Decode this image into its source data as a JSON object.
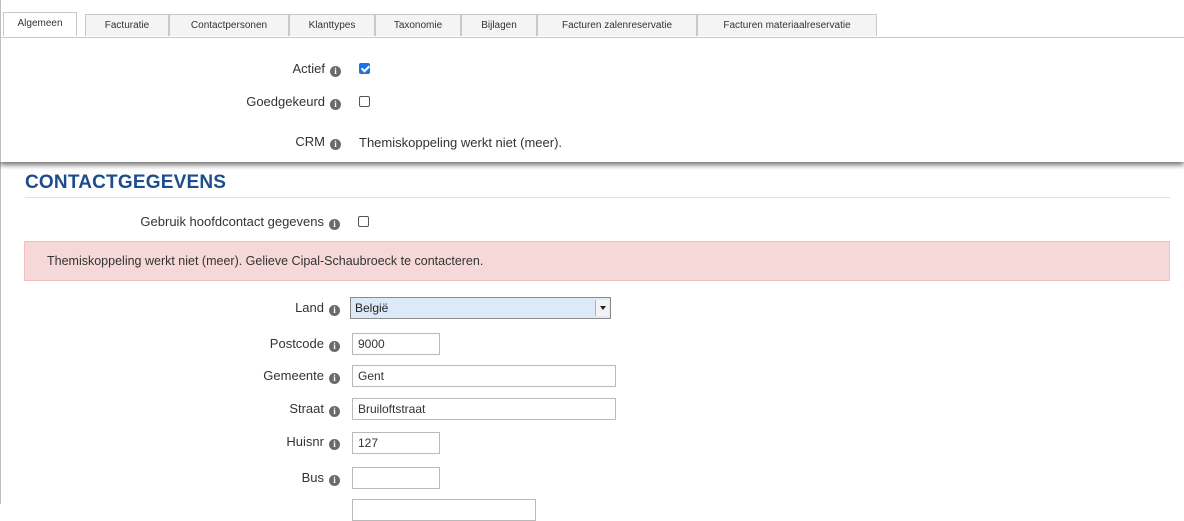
{
  "tabs": [
    {
      "label": "Algemeen",
      "active": true
    },
    {
      "label": "Facturatie",
      "active": false
    },
    {
      "label": "Contactpersonen",
      "active": false
    },
    {
      "label": "Klanttypes",
      "active": false
    },
    {
      "label": "Taxonomie",
      "active": false
    },
    {
      "label": "Bijlagen",
      "active": false
    },
    {
      "label": "Facturen zalenreservatie",
      "active": false
    },
    {
      "label": "Facturen materiaalreservatie",
      "active": false
    }
  ],
  "general": {
    "actief": {
      "label": "Actief",
      "checked": true
    },
    "goedgekeurd": {
      "label": "Goedgekeurd",
      "checked": false
    },
    "crm": {
      "label": "CRM",
      "value": "Themiskoppeling werkt niet (meer)."
    }
  },
  "contact": {
    "section_title": "CONTACTGEGEVENS",
    "use_main_contact": {
      "label": "Gebruik hoofdcontact gegevens",
      "checked": false
    },
    "alert": "Themiskoppeling werkt niet (meer). Gelieve Cipal-Schaubroeck te contacteren.",
    "land": {
      "label": "Land",
      "value": "België"
    },
    "postcode": {
      "label": "Postcode",
      "value": "9000"
    },
    "gemeente": {
      "label": "Gemeente",
      "value": "Gent"
    },
    "straat": {
      "label": "Straat",
      "value": "Bruiloftstraat"
    },
    "huisnr": {
      "label": "Huisnr",
      "value": "127"
    },
    "bus": {
      "label": "Bus",
      "value": ""
    }
  },
  "info_icon": "info-icon",
  "colors": {
    "section_title": "#1d4d8c",
    "alert_background": "#f7d8d8",
    "select_background": "#dde9f8",
    "checkbox_checked": "#1a73e8"
  }
}
